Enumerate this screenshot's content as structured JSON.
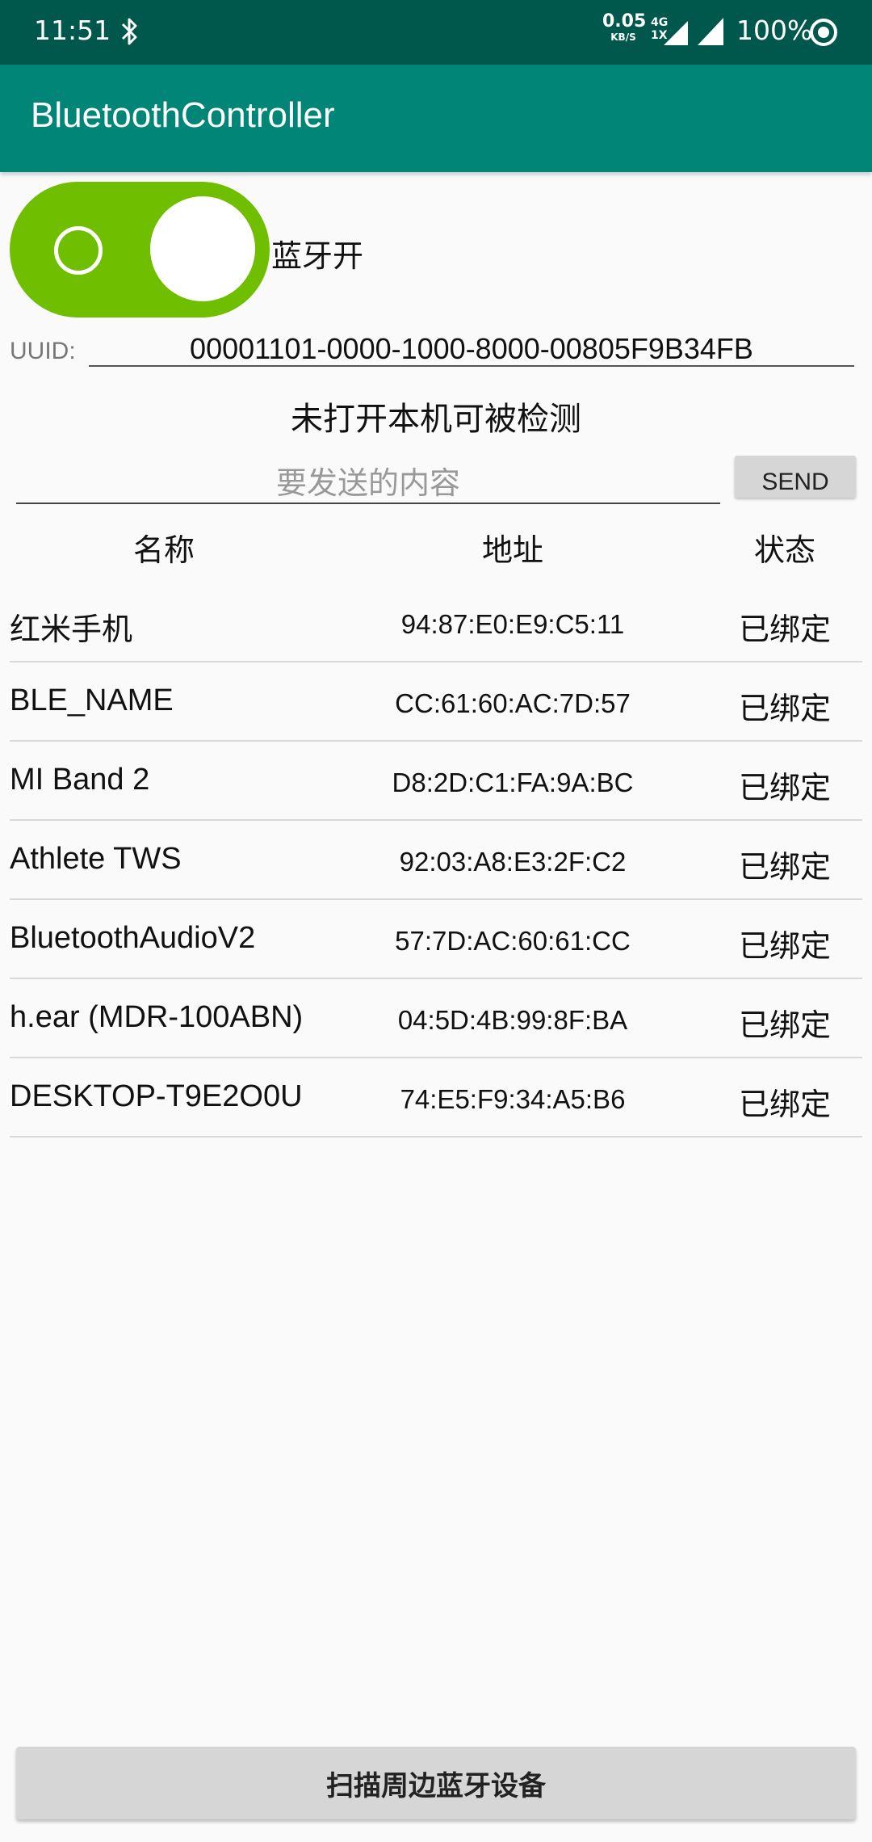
{
  "status_bar": {
    "time": "11:51",
    "net_speed_value": "0.05",
    "net_speed_unit": "KB/S",
    "net_type_top": "4G",
    "net_type_bottom": "1X",
    "battery": "100%",
    "icons": [
      "bluetooth-icon",
      "signal-icon",
      "signal-icon",
      "ring-icon"
    ]
  },
  "app_bar": {
    "title": "BluetoothController"
  },
  "bluetooth_switch": {
    "label": "蓝牙开",
    "state": "on",
    "accent_color": "#6fbf00"
  },
  "uuid": {
    "label": "UUID:",
    "value": "00001101-0000-1000-8000-00805F9B34FB"
  },
  "discoverable_status": "未打开本机可被检测",
  "send": {
    "placeholder": "要发送的内容",
    "value": "",
    "button_label": "SEND"
  },
  "table": {
    "headers": {
      "name": "名称",
      "address": "地址",
      "status": "状态"
    },
    "devices": [
      {
        "name": "红米手机",
        "address": "94:87:E0:E9:C5:11",
        "status": "已绑定"
      },
      {
        "name": "BLE_NAME",
        "address": "CC:61:60:AC:7D:57",
        "status": "已绑定"
      },
      {
        "name": "MI Band 2",
        "address": "D8:2D:C1:FA:9A:BC",
        "status": "已绑定"
      },
      {
        "name": "Athlete TWS",
        "address": "92:03:A8:E3:2F:C2",
        "status": "已绑定"
      },
      {
        "name": "BluetoothAudioV2",
        "address": "57:7D:AC:60:61:CC",
        "status": "已绑定"
      },
      {
        "name": "h.ear (MDR-100ABN)",
        "address": "04:5D:4B:99:8F:BA",
        "status": "已绑定"
      },
      {
        "name": "DESKTOP-T9E2O0U",
        "address": "74:E5:F9:34:A5:B6",
        "status": "已绑定"
      }
    ]
  },
  "scan_button": {
    "label": "扫描周边蓝牙设备"
  },
  "colors": {
    "status_bar": "#00574b",
    "app_bar": "#008577",
    "background": "#fafafa"
  }
}
